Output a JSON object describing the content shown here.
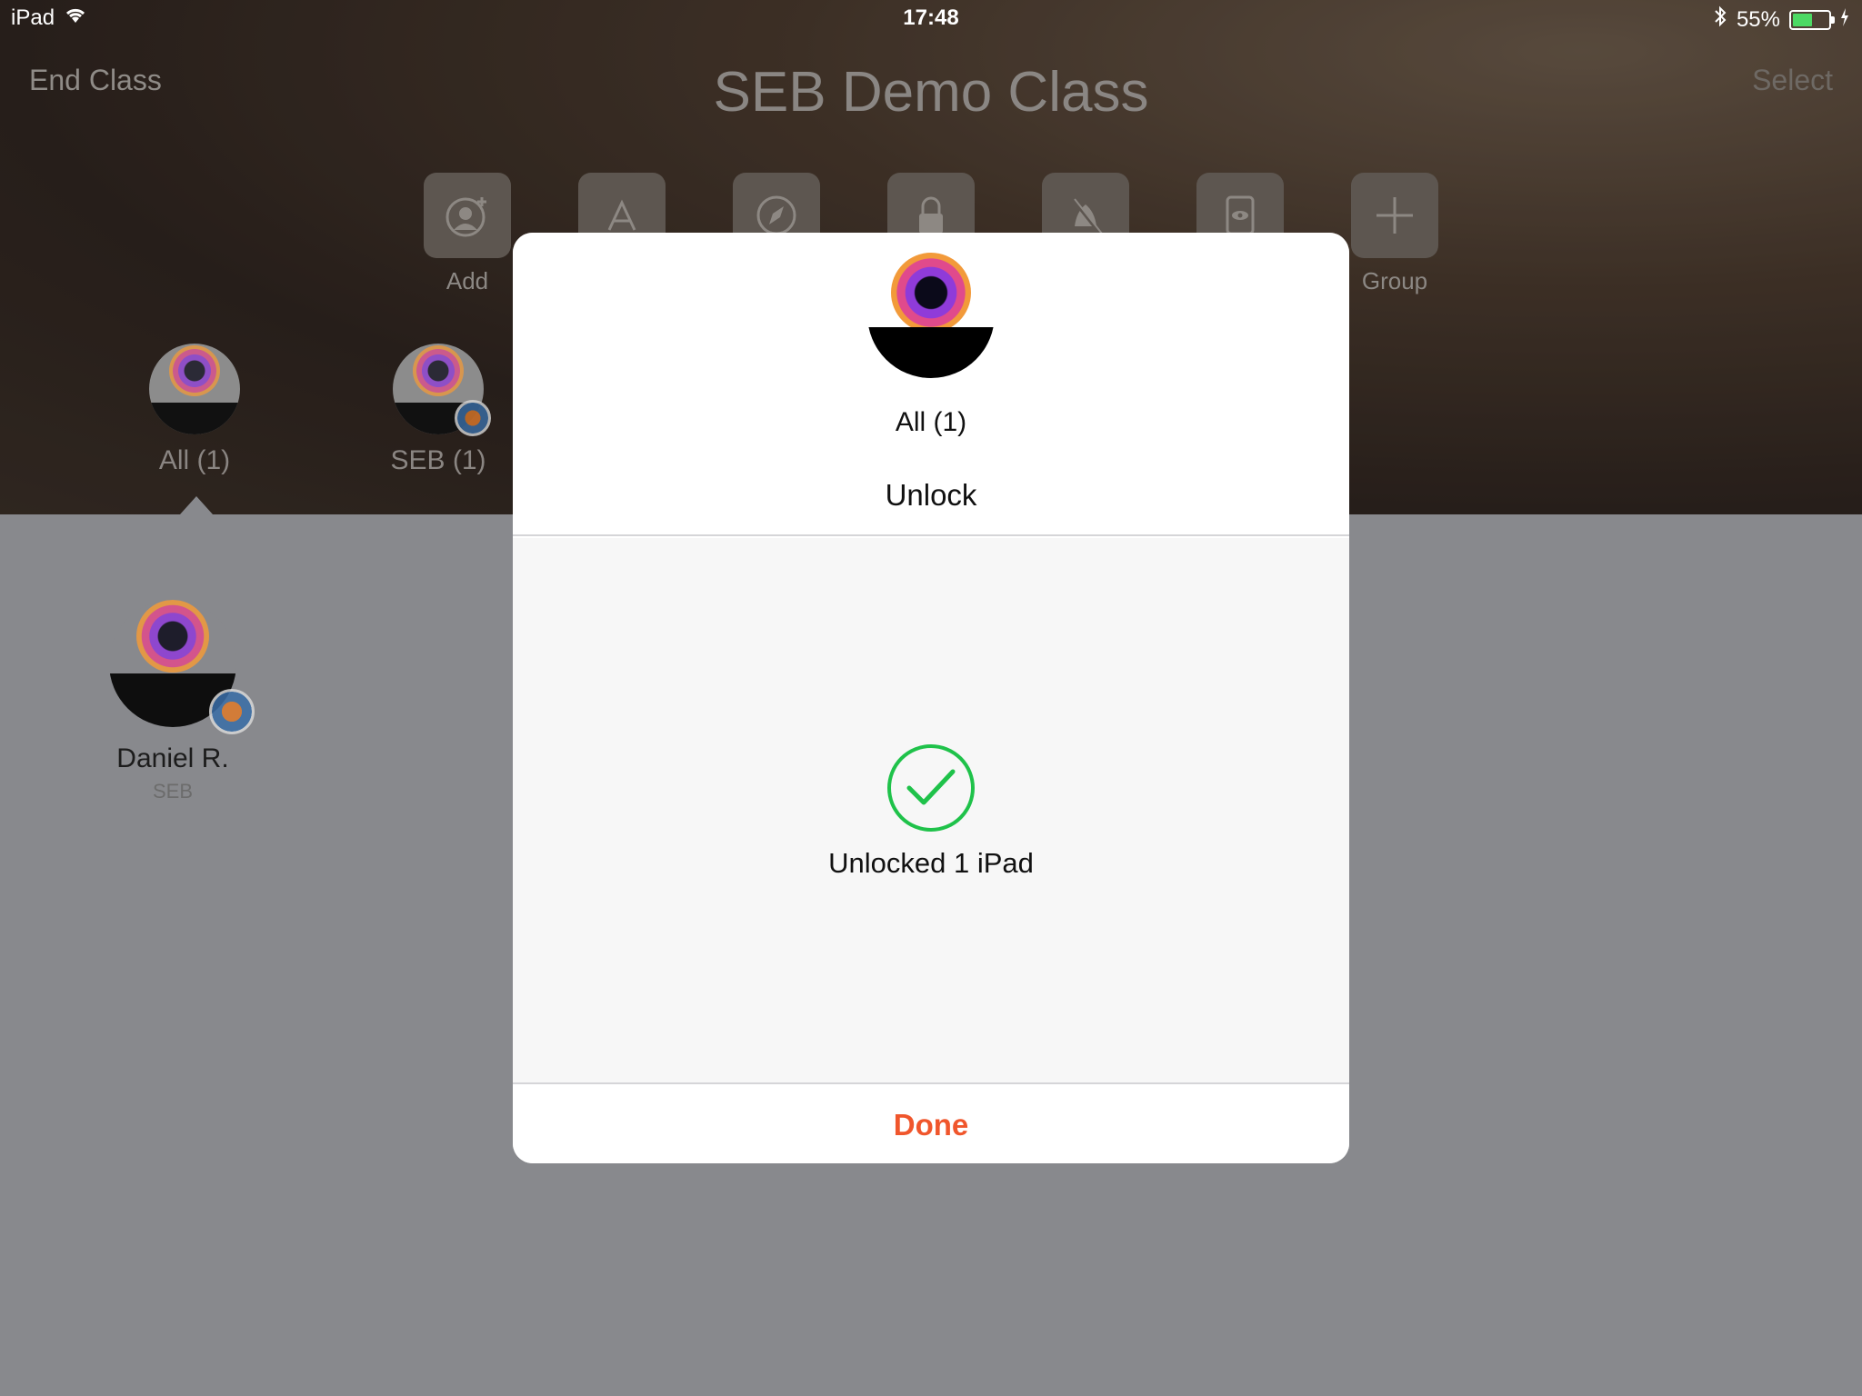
{
  "status_bar": {
    "device": "iPad",
    "time": "17:48",
    "battery_percent": "55%",
    "battery_level": 0.55
  },
  "nav": {
    "left_label": "End Class",
    "title": "SEB Demo Class",
    "right_label": "Select"
  },
  "toolbar": {
    "add_label": "Add",
    "group_label": "Group",
    "icons": [
      "add-student-icon",
      "app-store-icon",
      "safari-icon",
      "lock-icon",
      "mute-icon",
      "screen-view-icon",
      "plus-icon"
    ]
  },
  "groups": [
    {
      "label": "All (1)"
    },
    {
      "label": "SEB (1)"
    }
  ],
  "student": {
    "name": "Daniel R.",
    "app": "SEB"
  },
  "modal": {
    "group": "All (1)",
    "action": "Unlock",
    "result": "Unlocked 1 iPad",
    "done_label": "Done"
  },
  "colors": {
    "accent": "#f0562c",
    "success": "#1fc24a",
    "battery": "#4cd964"
  }
}
